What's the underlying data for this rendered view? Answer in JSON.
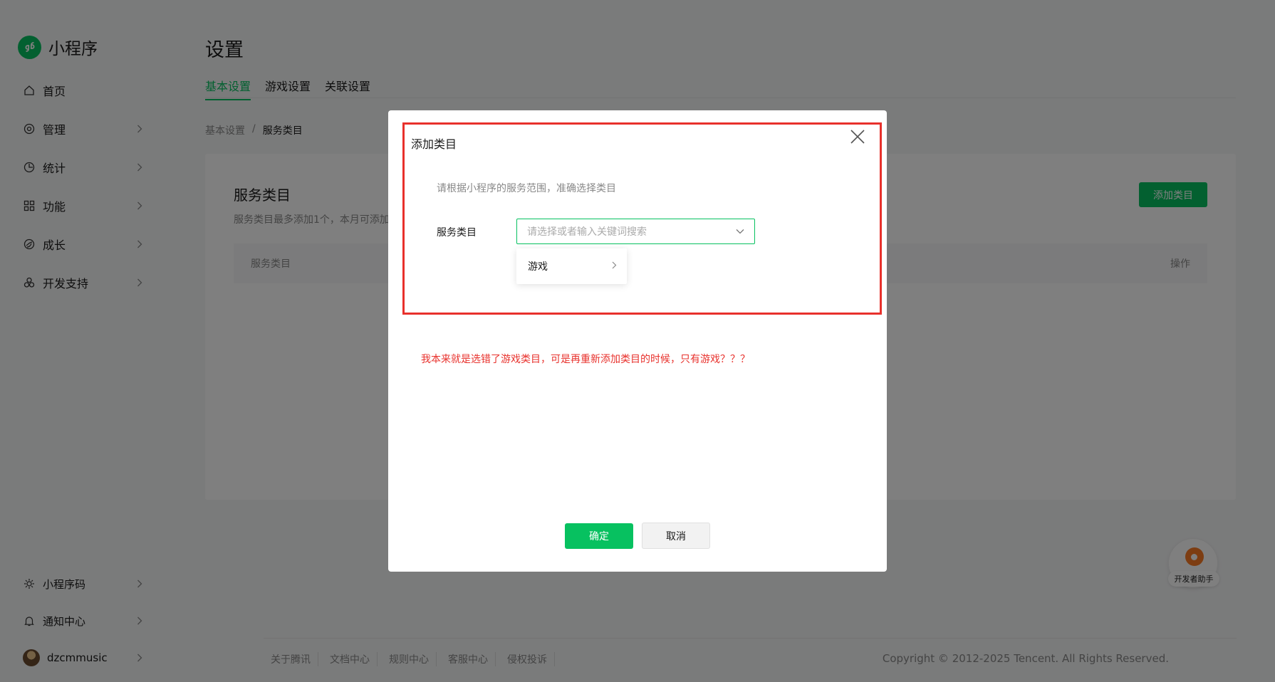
{
  "app": {
    "name": "小程序"
  },
  "sidebar": {
    "items": [
      {
        "label": "首页"
      },
      {
        "label": "管理"
      },
      {
        "label": "统计"
      },
      {
        "label": "功能"
      },
      {
        "label": "成长"
      },
      {
        "label": "开发支持"
      }
    ],
    "bottom_items": [
      {
        "label": "小程序码"
      },
      {
        "label": "通知中心"
      }
    ],
    "user": {
      "name": "dzcmmusic"
    }
  },
  "header": {
    "title": "设置",
    "tabs": [
      {
        "label": "基本设置",
        "active": true
      },
      {
        "label": "游戏设置",
        "active": false
      },
      {
        "label": "关联设置",
        "active": false
      }
    ]
  },
  "breadcrumb": {
    "parent": "基本设置",
    "separator": "/",
    "current": "服务类目"
  },
  "card": {
    "title": "服务类目",
    "desc": "服务类目最多添加1个，本月可添加",
    "add_button": "添加类目",
    "columns": [
      "服务类目",
      "操作"
    ]
  },
  "dialog": {
    "title": "添加类目",
    "tip": "请根据小程序的服务范围，准确选择类目",
    "field_label": "服务类目",
    "select_placeholder": "请选择或者输入关键词搜索",
    "dropdown_options": [
      {
        "label": "游戏"
      }
    ],
    "annotation": "我本来就是选错了游戏类目，可是再重新添加类目的时候，只有游戏？？？",
    "confirm": "确定",
    "cancel": "取消"
  },
  "helper": {
    "label": "开发者助手"
  },
  "footer": {
    "links": [
      "关于腾讯",
      "文档中心",
      "规则中心",
      "客服中心",
      "侵权投诉"
    ],
    "copyright": "Copyright © 2012-2025 Tencent. All Rights Reserved."
  },
  "colors": {
    "brand": "#07c160",
    "annotation": "#e8312c",
    "overlay": "rgba(0,0,0,0.5)"
  }
}
